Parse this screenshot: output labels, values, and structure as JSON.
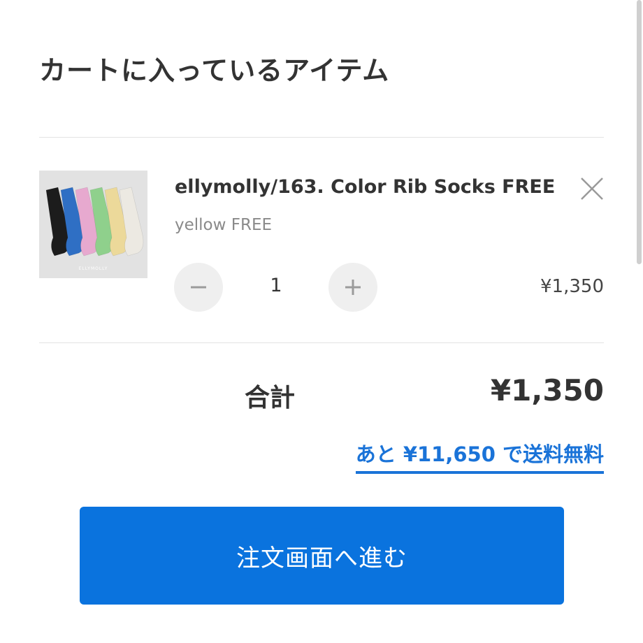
{
  "cart": {
    "title": "カートに入っているアイテム",
    "items": [
      {
        "name": "ellymolly/163. Color Rib Socks FREE",
        "variant": "yellow FREE",
        "quantity": "1",
        "price": "¥1,350",
        "image_logo": "ELLYMOLLY",
        "sock_colors": [
          "#1c1c1c",
          "#2f6fc4",
          "#e7a9cf",
          "#8fd08c",
          "#ecd99a",
          "#ece9e2"
        ]
      }
    ]
  },
  "summary": {
    "total_label": "合計",
    "total_value": "¥1,350",
    "shipping_note": "あと ¥11,650 で送料無料"
  },
  "checkout": {
    "label": "注文画面へ進む"
  },
  "colors": {
    "accent": "#0a73de",
    "link": "#1a73d8"
  }
}
